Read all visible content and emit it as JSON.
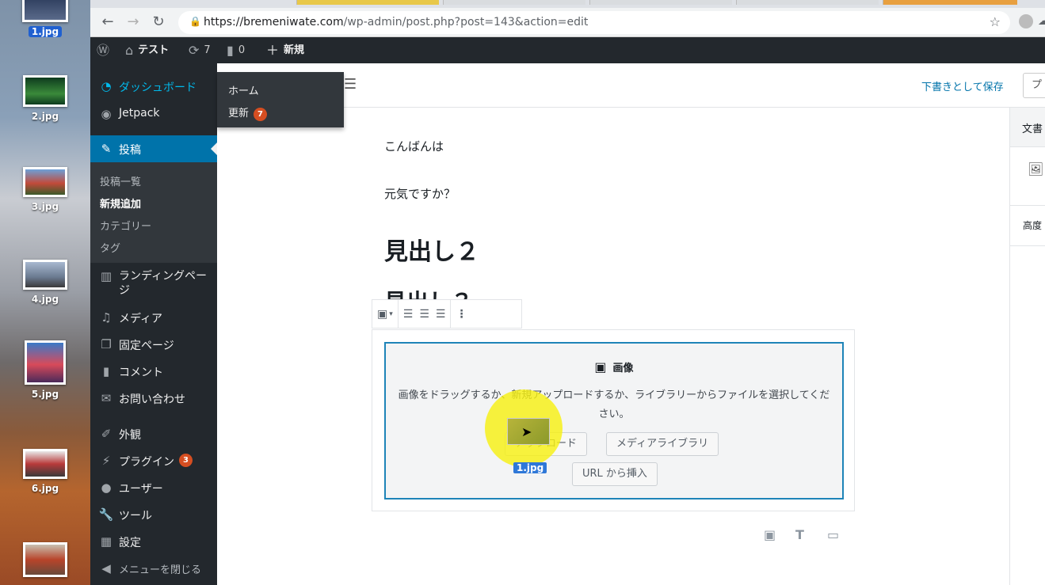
{
  "desktop": {
    "files": [
      {
        "name": "1.jpg",
        "selected": true
      },
      {
        "name": "2.jpg",
        "selected": false
      },
      {
        "name": "3.jpg",
        "selected": false
      },
      {
        "name": "4.jpg",
        "selected": false
      },
      {
        "name": "5.jpg",
        "selected": false
      },
      {
        "name": "6.jpg",
        "selected": false
      }
    ]
  },
  "browser": {
    "url_host": "https://bremeniwate.com",
    "url_path": "/wp-admin/post.php?post=143&action=edit"
  },
  "adminbar": {
    "site_name": "テスト",
    "updates_count": "7",
    "comments_count": "0",
    "new_label": "新規"
  },
  "sidebar": {
    "dashboard": "ダッシュボード",
    "jetpack": "Jetpack",
    "posts": "投稿",
    "posts_sub": [
      "投稿一覧",
      "新規追加",
      "カテゴリー",
      "タグ"
    ],
    "landing_line1": "ランディングペー",
    "landing_line2": "ジ",
    "media": "メディア",
    "pages": "固定ページ",
    "comments": "コメント",
    "contact": "お問い合わせ",
    "appearance": "外観",
    "plugins": "プラグイン",
    "plugins_badge": "3",
    "users": "ユーザー",
    "tools": "ツール",
    "settings": "設定",
    "collapse": "メニューを閉じる"
  },
  "flyout": {
    "home": "ホーム",
    "updates": "更新",
    "updates_badge": "7"
  },
  "editor": {
    "save_draft": "下書きとして保存",
    "publish_partial": "プ",
    "panel_tab": "文書",
    "panel_height": "高度",
    "para1": "こんばんは",
    "para2": "元気ですか？",
    "heading1": "見出し２",
    "heading2_partial": "見出し３",
    "image_block": {
      "title": "画像",
      "instructions": "画像をドラッグするか、新規アップロードするか、ライブラリーからファイルを選択してください。",
      "upload_btn": "アップロード",
      "media_btn": "メディアライブラリ",
      "url_btn": "URL から挿入"
    },
    "drag_file": "1.jpg"
  }
}
